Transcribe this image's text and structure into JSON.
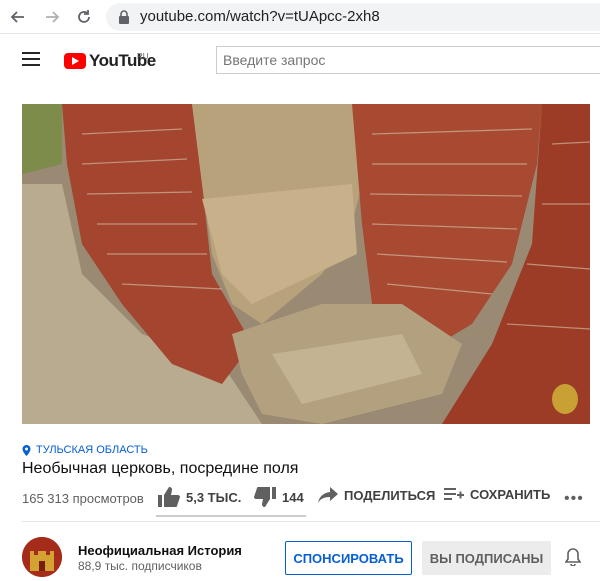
{
  "browser": {
    "url": "youtube.com/watch?v=tUApcc-2xh8"
  },
  "header": {
    "logo_text": "YouTube",
    "logo_region": "RU",
    "search_placeholder": "Введите запрос"
  },
  "video": {
    "location": "ТУЛЬСКАЯ ОБЛАСТЬ",
    "title": "Необычная церковь, посредине поля",
    "views": "165 313 просмотров",
    "likes": "5,3 ТЫС.",
    "dislikes": "144",
    "share_label": "ПОДЕЛИТЬСЯ",
    "save_label": "СОХРАНИТЬ",
    "more_label": "•••"
  },
  "channel": {
    "name": "Неофициальная История",
    "subscribers": "88,9 тыс. подписчиков",
    "sponsor_label": "СПОНСИРОВАТЬ",
    "subscribed_label": "ВЫ ПОДПИСАНЫ"
  },
  "colors": {
    "accent": "#065fd4",
    "brand": "#ff0000"
  }
}
